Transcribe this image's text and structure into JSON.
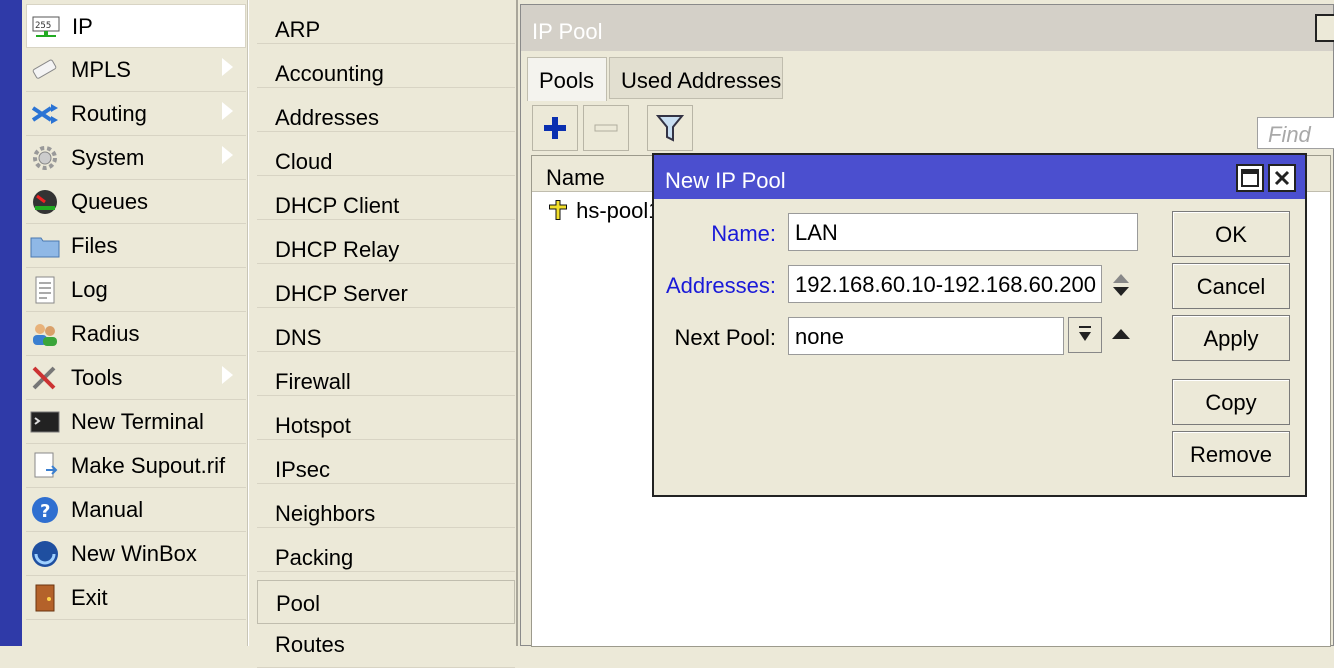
{
  "main_menu": {
    "items": [
      {
        "label": "IP",
        "icon": "ip-icon",
        "arrow": true
      },
      {
        "label": "MPLS",
        "icon": "mpls-icon",
        "arrow": true
      },
      {
        "label": "Routing",
        "icon": "routing-icon",
        "arrow": true
      },
      {
        "label": "System",
        "icon": "gear-icon",
        "arrow": true
      },
      {
        "label": "Queues",
        "icon": "queues-icon",
        "arrow": false
      },
      {
        "label": "Files",
        "icon": "folder-icon",
        "arrow": false
      },
      {
        "label": "Log",
        "icon": "log-icon",
        "arrow": false
      },
      {
        "label": "Radius",
        "icon": "radius-icon",
        "arrow": false
      },
      {
        "label": "Tools",
        "icon": "tools-icon",
        "arrow": true
      },
      {
        "label": "New Terminal",
        "icon": "terminal-icon",
        "arrow": false
      },
      {
        "label": "Make Supout.rif",
        "icon": "supout-icon",
        "arrow": false
      },
      {
        "label": "Manual",
        "icon": "help-icon",
        "arrow": false
      },
      {
        "label": "New WinBox",
        "icon": "winbox-icon",
        "arrow": false
      },
      {
        "label": "Exit",
        "icon": "exit-icon",
        "arrow": false
      }
    ]
  },
  "ip_submenu": {
    "items": [
      "ARP",
      "Accounting",
      "Addresses",
      "Cloud",
      "DHCP Client",
      "DHCP Relay",
      "DHCP Server",
      "DNS",
      "Firewall",
      "Hotspot",
      "IPsec",
      "Neighbors",
      "Packing",
      "Pool",
      "Routes"
    ]
  },
  "pool_window": {
    "title": "IP Pool",
    "tabs": [
      "Pools",
      "Used Addresses"
    ],
    "find_placeholder": "Find",
    "column_name": "Name",
    "rows": [
      {
        "name": "hs-pool1"
      }
    ]
  },
  "dialog": {
    "title": "New IP Pool",
    "name_label": "Name:",
    "name_value": "LAN",
    "addresses_label": "Addresses:",
    "addresses_value": "192.168.60.10-192.168.60.200",
    "next_pool_label": "Next Pool:",
    "next_pool_value": "none",
    "buttons": {
      "ok": "OK",
      "cancel": "Cancel",
      "apply": "Apply",
      "copy": "Copy",
      "remove": "Remove"
    }
  },
  "colors": {
    "accent_blue": "#4b4fcf",
    "label_blue": "#1a1ad8",
    "side_strip": "#2f3aa8"
  }
}
